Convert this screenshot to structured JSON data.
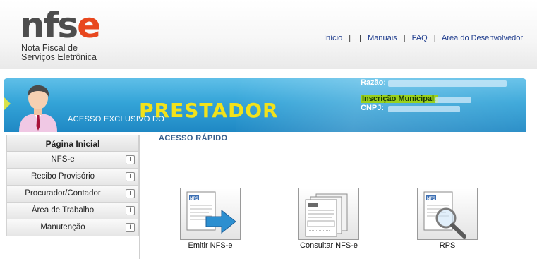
{
  "logo": {
    "word_main": "nfs",
    "word_accent": "e",
    "line1": "Nota Fiscal de",
    "line2": "Serviços Eletrônica"
  },
  "topnav": {
    "items": [
      "Início",
      "Manuais",
      "FAQ",
      "Area do Desenvolvedor"
    ],
    "separator": "|"
  },
  "banner": {
    "tag": "ACESSO EXCLUSIVO DO",
    "role": "PRESTADOR",
    "razao_label": "Razão:",
    "inscricao_label": "Inscrição Municipal:",
    "cnpj_label": "CNPJ:"
  },
  "sidebar": {
    "title": "Página Inicial",
    "items": [
      {
        "label": "NFS-e"
      },
      {
        "label": "Recibo Provisório"
      },
      {
        "label": "Procurador/Contador"
      },
      {
        "label": "Área de Trabalho"
      },
      {
        "label": "Manutenção"
      }
    ],
    "expand_symbol": "+"
  },
  "quick_access": {
    "title": "ACESSO RÁPIDO",
    "items": [
      {
        "label": "Emitir NFS-e",
        "icon": "emit-nfse-icon"
      },
      {
        "label": "Consultar NFS-e",
        "icon": "consult-nfse-icon"
      },
      {
        "label": "RPS",
        "icon": "rps-icon"
      }
    ]
  },
  "colors": {
    "banner_blue": "#34a4d8",
    "role_yellow": "#f2e21a",
    "logo_orange": "#e8471e",
    "link_blue": "#1c3a8c",
    "inscricao_highlight": "#9ad11c"
  }
}
